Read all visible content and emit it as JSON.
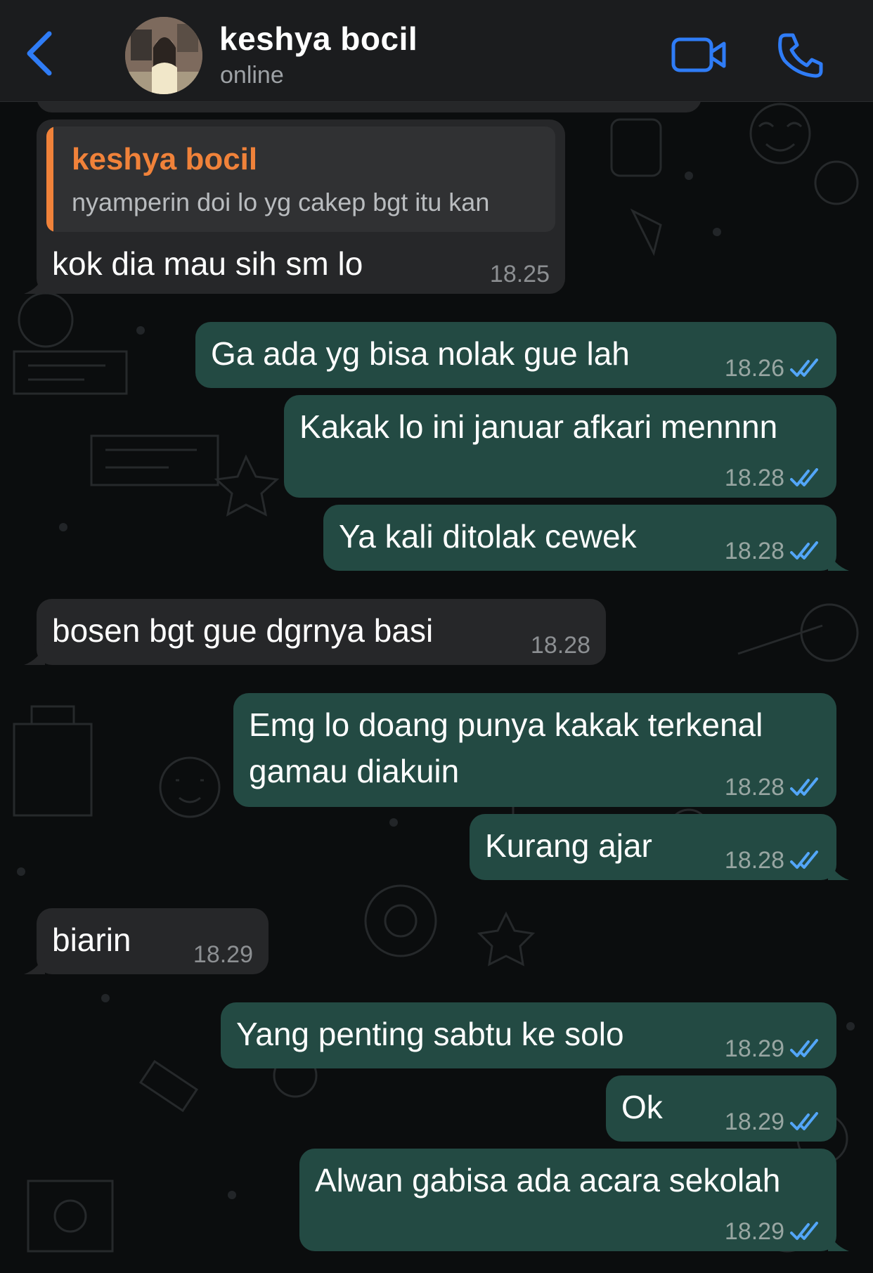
{
  "header": {
    "back_icon": "chevron-left-icon",
    "contact_name": "keshya bocil",
    "status": "online",
    "video_icon": "video-camera-icon",
    "call_icon": "phone-icon",
    "accent_color": "#2f7cf6"
  },
  "colors": {
    "incoming_bubble": "#262729",
    "outgoing_bubble": "#234a43",
    "quote_accent": "#f0823a",
    "read_tick": "#53a6f8"
  },
  "messages": [
    {
      "direction": "incoming",
      "quote": {
        "author": "keshya bocil",
        "text": "nyamperin doi lo yg cakep bgt itu kan"
      },
      "text": "kok dia mau sih sm lo",
      "time": "18.25"
    },
    {
      "direction": "outgoing",
      "text": "Ga ada yg bisa nolak gue lah",
      "time": "18.26",
      "status": "read"
    },
    {
      "direction": "outgoing",
      "text": "Kakak lo ini januar afkari mennnn",
      "time": "18.28",
      "status": "read"
    },
    {
      "direction": "outgoing",
      "text": "Ya kali ditolak cewek",
      "time": "18.28",
      "status": "read"
    },
    {
      "direction": "incoming",
      "text": "bosen bgt gue dgrnya basi",
      "time": "18.28"
    },
    {
      "direction": "outgoing",
      "text": "Emg lo doang punya kakak terkenal\ngamau diakuin",
      "time": "18.28",
      "status": "read"
    },
    {
      "direction": "outgoing",
      "text": "Kurang ajar",
      "time": "18.28",
      "status": "read"
    },
    {
      "direction": "incoming",
      "text": "biarin",
      "time": "18.29"
    },
    {
      "direction": "outgoing",
      "text": "Yang penting sabtu ke solo",
      "time": "18.29",
      "status": "read"
    },
    {
      "direction": "outgoing",
      "text": "Ok",
      "time": "18.29",
      "status": "read"
    },
    {
      "direction": "outgoing",
      "text": "Alwan gabisa ada acara sekolah",
      "time": "18.29",
      "status": "read"
    }
  ]
}
